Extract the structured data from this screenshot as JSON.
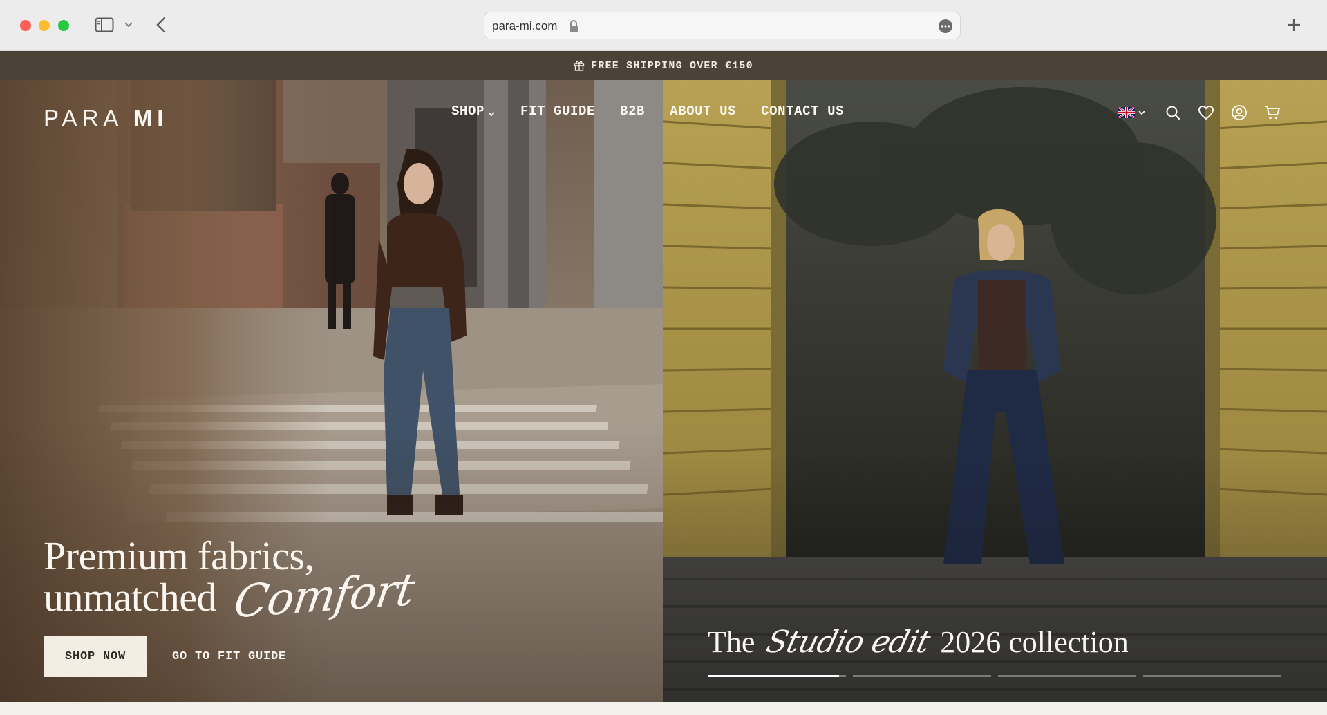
{
  "browser": {
    "url": "para-mi.com"
  },
  "announcement": {
    "text": "FREE SHIPPING OVER €150"
  },
  "header": {
    "logo_light": "PARA",
    "logo_bold": "MI",
    "nav": [
      {
        "label": "SHOP",
        "has_dropdown": true
      },
      {
        "label": "FIT GUIDE"
      },
      {
        "label": "B2B"
      },
      {
        "label": "ABOUT US"
      },
      {
        "label": "CONTACT US"
      }
    ],
    "icons": [
      "uk-flag-icon",
      "search-icon",
      "heart-icon",
      "account-icon",
      "cart-icon"
    ]
  },
  "hero_left": {
    "headline_line1": "Premium fabrics,",
    "headline_line2": "unmatched",
    "headline_script": "Comfort",
    "primary_cta": "SHOP NOW",
    "secondary_cta": "GO TO FIT GUIDE"
  },
  "hero_right": {
    "caption_pre": "The",
    "caption_script": "Studio edit",
    "caption_post": "2026 collection",
    "slides_total": 4,
    "active_slide": 1,
    "active_progress": 0.95
  },
  "colors": {
    "announcement_bg": "#4b4238",
    "button_bg": "#f3ede4",
    "text_light": "#fbf7f0"
  }
}
